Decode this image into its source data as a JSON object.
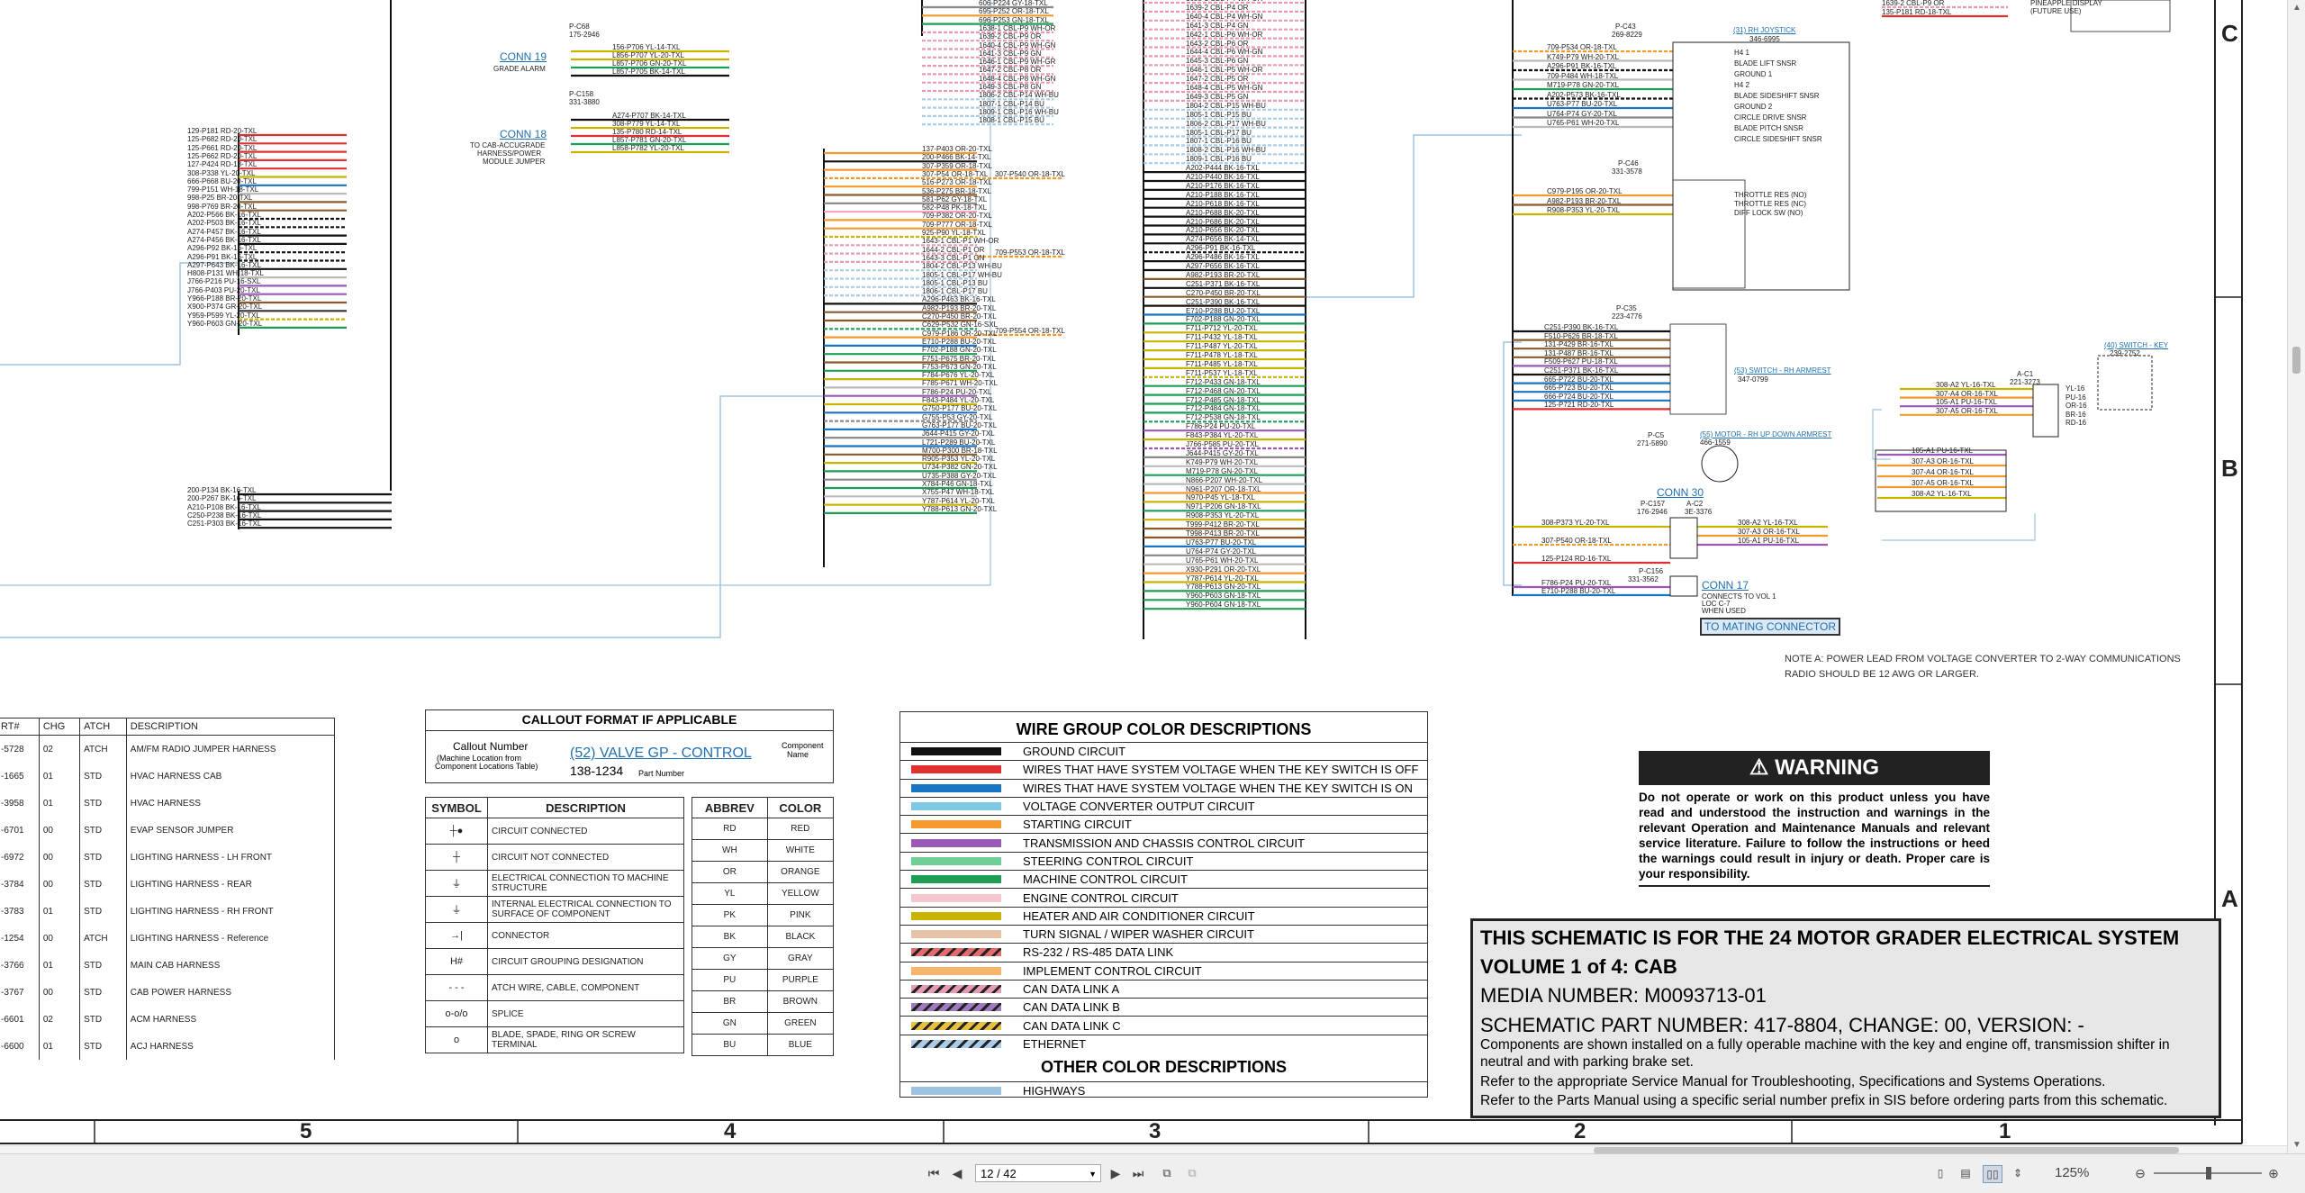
{
  "zones": {
    "c": "C",
    "b": "B",
    "a": "A"
  },
  "columns": [
    "5",
    "4",
    "3",
    "2",
    "1"
  ],
  "left_harness": [
    "129-P181 RD-20-TXL",
    "125-P682 RD-20-TXL",
    "125-P661 RD-20-TXL",
    "125-P662 RD-20-TXL",
    "127-P424 RD-18-TXL",
    "308-P338 YL-20-TXL",
    "666-P668 BU-20-TXL",
    "799-P151 WH-18-TXL",
    "998-P25 BR-20-TXL",
    "998-P769 BR-20-TXL",
    "A202-P566 BK-16-TXL",
    "A202-P503 BK-16-TXL",
    "A274-P457 BK-16-TXL",
    "A274-P456 BK-16-TXL",
    "A296-P92 BK-16-TXL",
    "A296-P91 BK-16-TXL",
    "A297-P643 BK-16-TXL",
    "H808-P131 WH-18-TXL",
    "J766-P216 PU-16-SXL",
    "J766-P403 PU-20-TXL",
    "Y966-P188 BR-20-TXL",
    "X900-P374 GR-20-TXL",
    "Y959-P599 YL-20-TXL",
    "Y960-P603 GN-20-TXL"
  ],
  "left_harness_low": [
    "200-P134 BK-16-TXL",
    "200-P267 BK-16-TXL",
    "A210-P108 BK-16-TXL",
    "C250-P238 BK-16-TXL",
    "C251-P303 BK-16-TXL"
  ],
  "conn19": {
    "title": "CONN 19",
    "sub": "GRADE ALARM",
    "pc": "P-C68",
    "pn": "175-2946",
    "wires": [
      "156-P706 YL-14-TXL",
      "L856-P707 YL-20-TXL",
      "L857-P706 GN-20-TXL",
      "L857-P705 BK-14-TXL"
    ]
  },
  "conn18": {
    "title": "CONN 18",
    "sub1": "TO CAB-ACCUGRADE",
    "sub2": "HARNESS/POWER",
    "sub3": "MODULE JUMPER",
    "pc": "P-C158",
    "pn": "331-3880",
    "wires": [
      "A274-P707 BK-14-TXL",
      "308-P779 YL-14-TXL",
      "135-P780 RD-14-TXL",
      "L857-P781 GN-20-TXL",
      "L858-P782 YL-20-TXL"
    ]
  },
  "mid_harness_top": [
    "606-P224 GY-18-TXL",
    "695-P252 OR-18-TXL",
    "696-P253 GN-18-TXL",
    "1638-1 CBL-P9 WH-OR",
    "1639-2 CBL-P9 OR",
    "1640-4 CBL-P9 WH-GN",
    "1641-3 CBL-P9 GN",
    "1646-1 CBL-P9 WH-GR",
    "1647-2 CBL-P8 OR",
    "1648-4 CBL-P8 WH-GN",
    "1649-3 CBL-P8 GN",
    "1806-2 CBL-P14 WH-BU",
    "1807-1 CBL-P14 BU",
    "1809-1 CBL-P16 WH-BU",
    "1808-1 CBL-P15 BU"
  ],
  "mid_harness": [
    "137-P403 OR-20-TXL",
    "200-P466 BK-14-TXL",
    "307-P359 OR-18-TXL",
    "307-P54 OR-18-TXL",
    "516-P273 OR-18-TXL",
    "536-P275 BR-18-TXL",
    "581-P62 GY-18-TXL",
    "582-P48 PK-18-TXL",
    "709-P382 OR-20-TXL",
    "709-P777 OR-18-TXL",
    "925-P90 YL-18-TXL",
    "1643-1 CBL-P1 WH-OR",
    "1644-2 CBL-P1 OR",
    "1643-3 CBL-P1 GN",
    "1804-2 CBL-P13 WH-BU",
    "1805-1 CBL-P17 WH-BU",
    "1805-1 CBL-P13 BU",
    "1806-1 CBL-P17 BU",
    "A296-P463 BK-16-TXL",
    "A982-P193 BR-20-TXL",
    "C270-P450 BR-20-TXL",
    "C629-P532 GN-16-SXL",
    "C979-P186 OR-20-TXL",
    "E710-P288 BU-20-TXL",
    "F702-P188 GN-20-TXL",
    "F751-P675 BR-20-TXL",
    "F753-P673 GN-20-TXL",
    "F784-P676 YL-20-TXL",
    "F785-P671 WH-20-TXL",
    "F786-P24 PU-20-TXL",
    "F843-P484 YL-20-TXL",
    "G750-P177 BU-20-TXL",
    "G755-P53 GY-20-TXL",
    "G763-P177 BU-20-TXL",
    "J644-P415 GY-20-TXL",
    "L721-P289 BU-20-TXL",
    "M700-P300 BR-18-TXL",
    "R905-P353 YL-20-TXL",
    "U734-P382 GN-20-TXL",
    "U735-P388 GY-20-TXL",
    "X784-P46 GN-18-TXL",
    "X755-P47 WH-18-TXL",
    "Y787-P614 YL-20-TXL",
    "Y788-P613 GN-20-TXL"
  ],
  "mid_right": [
    "307-P540 OR-18-TXL",
    "709-P553 OR-18-TXL",
    "709-P554 OR-18-TXL"
  ],
  "trunk": [
    "1638-1 CBL-P4 WH-OR",
    "1639-2 CBL-P4 OR",
    "1640-4 CBL-P4 WH-GN",
    "1641-3 CBL-P4 GN",
    "1642-1 CBL-P6 WH-OR",
    "1643-2 CBL-P6 OR",
    "1644-4 CBL-P6 WH-GN",
    "1645-3 CBL-P6 GN",
    "1646-1 CBL-P5 WH-OR",
    "1647-2 CBL-P5 OR",
    "1648-4 CBL-P5 WH-GN",
    "1649-3 CBL-P5 GN",
    "1804-2 CBL-P15 WH-BU",
    "1805-1 CBL-P15 BU",
    "1806-2 CBL-P17 WH-BU",
    "1805-1 CBL-P17 BU",
    "1807-1 CBL-P16 BU",
    "1808-2 CBL-P16 WH-BU",
    "1809-1 CBL-P16 BU",
    "A202-P444 BK-16-TXL",
    "A210-P440 BK-16-TXL",
    "A210-P176 BK-16-TXL",
    "A210-P188 BK-16-TXL",
    "A210-P618 BK-16-TXL",
    "A210-P688 BK-20-TXL",
    "A210-P686 BK-20-TXL",
    "A210-P656 BK-20-TXL",
    "A274-P656 BK-14-TXL",
    "A296-P91 BK-16-TXL",
    "A296-P486 BK-16-TXL",
    "A297-P656 BK-16-TXL",
    "A982-P193 BR-20-TXL",
    "C251-P371 BK-16-TXL",
    "C270-P450 BR-20-TXL",
    "C251-P390 BK-16-TXL",
    "E710-P288 BU-20-TXL",
    "F702-P188 GN-20-TXL",
    "F711-P712 YL-20-TXL",
    "F711-P432 YL-18-TXL",
    "F711-P487 YL-20-TXL",
    "F711-P478 YL-18-TXL",
    "F711-P485 YL-18-TXL",
    "F711-P537 YL-18-TXL",
    "F712-P433 GN-18-TXL",
    "F712-P468 GN-20-TXL",
    "F712-P485 GN-18-TXL",
    "F712-P484 GN-18-TXL",
    "F712-P538 GN-18-TXL",
    "F786-P24 PU-20-TXL",
    "F843-P384 YL-20-TXL",
    "J766-P585 PU-20-TXL",
    "J644-P415 GY-20-TXL",
    "K749-P79 WH-20-TXL",
    "M719-P78 GN-20-TXL",
    "N866-P207 WH-20-TXL",
    "N961-P207 OR-18-TXL",
    "N970-P45 YL-18-TXL",
    "N971-P206 GN-18-TXL",
    "R908-P353 YL-20-TXL",
    "T999-P412 BR-20-TXL",
    "T998-P413 BR-20-TXL",
    "U763-P77 BU-20-TXL",
    "U764-P74 GY-20-TXL",
    "U765-P61 WH-20-TXL",
    "X930-P291 OR-20-TXL",
    "Y787-P614 YL-20-TXL",
    "Y788-P613 GN-20-TXL",
    "Y960-P603 GN-18-TXL",
    "Y960-P604 GN-18-TXL"
  ],
  "topright": {
    "wires": [
      "1639-2 CBL-P9 OR",
      "135-P181 RD-18-TXL"
    ],
    "note1": "PINEAPPLE DISPLAY",
    "note2": "(FUTURE USE)"
  },
  "joystick": {
    "pc": "P-C43",
    "pn": "269-8229",
    "title": "(31) RH JOYSTICK",
    "num": "346-6995",
    "wires": [
      "709-P534 OR-18-TXL",
      "K749-P79 WH-20-TXL",
      "A296-P91 BK-16-TXL",
      "709-P484 WH-18-TXL",
      "M719-P78 GN-20-TXL",
      "A202-P573 BK-16-TXL",
      "U763-P77 BU-20-TXL",
      "U764-P74 GY-20-TXL",
      "U765-P61 WH-20-TXL"
    ],
    "labels": [
      "H4 1",
      "BLADE LIFT SNSR",
      "GROUND 1",
      "H4 2",
      "BLADE SIDESHIFT SNSR",
      "GROUND 2",
      "CIRCLE DRIVE SNSR",
      "BLADE PITCH SNSR",
      "CIRCLE SIDESHIFT SNSR"
    ],
    "pc2": "P-C46",
    "pn2": "331-3578",
    "wires2": [
      "C979-P195 OR-20-TXL",
      "A982-P193 BR-20-TXL",
      "R908-P353 YL-20-TXL"
    ],
    "labels2": [
      "THROTTLE RES (NO)",
      "THROTTLE RES (NC)",
      "DIFF LOCK SW (NO)"
    ]
  },
  "armrest": {
    "pc": "P-C35",
    "pn": "223-4776",
    "title": "(53) SWITCH - RH ARMREST",
    "num": "347-0799",
    "wires": [
      "C251-P390 BK-16-TXL",
      "F510-P626 BR-18-TXL",
      "131-P429 BR-16-TXL",
      "131-P487 BR-16-TXL",
      "F509-P627 PU-18-TXL",
      "C251-P371 BK-16-TXL",
      "665-P722 BU-20-TXL",
      "665-P723 BU-20-TXL",
      "666-P724 BU-20-TXL",
      "125-P721 RD-20-TXL"
    ]
  },
  "motor": {
    "pc": "P-C5",
    "pn": "271-5890",
    "title": "(55) MOTOR - RH UP DOWN ARMREST",
    "num": "466-1559"
  },
  "keyswitch": {
    "title": "(40) SWITCH - KEY",
    "num": "239-2752",
    "pc": "A-C1",
    "pn": "221-3273",
    "wires": [
      "308-A2 YL-16-TXL",
      "307-A4 OR-16-TXL",
      "105-A1 PU-16-TXL",
      "307-A5 OR-16-TXL"
    ],
    "pins": [
      "YL-16",
      "PU-16",
      "OR-16",
      "BR-16",
      "RD-16"
    ],
    "loop": [
      "105-A1 PU-16-TXL",
      "307-A3 OR-16-TXL",
      "307-A4 OR-16-TXL",
      "307-A5 OR-16-TXL",
      "308-A2 YL-16-TXL"
    ]
  },
  "conn30": {
    "title": "CONN 30",
    "pc": "P-C157",
    "pn": "176-2946",
    "ac": "A-C2",
    "an": "3E-3376",
    "wires": [
      "308-P373 YL-20-TXL",
      "307-P540 OR-18-TXL",
      "125-P124 RD-16-TXL"
    ],
    "right": [
      "308-A2 YL-16-TXL",
      "307-A3 OR-16-TXL",
      "105-A1 PU-16-TXL"
    ]
  },
  "conn17": {
    "title": "CONN 17",
    "pc": "P-C156",
    "pn": "331-3562",
    "wires": [
      "F786-P24 PU-20-TXL",
      "E710-P288 BU-20-TXL"
    ],
    "sub1": "CONNECTS TO VOL 1",
    "sub2": "LOC C-7",
    "sub3": "WHEN USED",
    "mating": "TO MATING CONNECTOR"
  },
  "note_a": {
    "line1": "NOTE A: POWER LEAD FROM VOLTAGE CONVERTER TO 2-WAY COMMUNICATIONS",
    "line2": "RADIO SHOULD BE 12 AWG OR LARGER."
  },
  "parts_table": {
    "headers": [
      "RT#",
      "CHG",
      "ATCH",
      "DESCRIPTION"
    ],
    "rows": [
      [
        "-5728",
        "02",
        "ATCH",
        "AM/FM RADIO JUMPER HARNESS"
      ],
      [
        "-1665",
        "01",
        "STD",
        "HVAC HARNESS CAB"
      ],
      [
        "-3958",
        "01",
        "STD",
        "HVAC HARNESS"
      ],
      [
        "-6701",
        "00",
        "STD",
        "EVAP SENSOR JUMPER"
      ],
      [
        "-6972",
        "00",
        "STD",
        "LIGHTING HARNESS - LH FRONT"
      ],
      [
        "-3784",
        "00",
        "STD",
        "LIGHTING HARNESS - REAR"
      ],
      [
        "-3783",
        "01",
        "STD",
        "LIGHTING HARNESS - RH FRONT"
      ],
      [
        "-1254",
        "00",
        "ATCH",
        "LIGHTING HARNESS - Reference"
      ],
      [
        "-3766",
        "01",
        "STD",
        "MAIN CAB HARNESS"
      ],
      [
        "-3767",
        "00",
        "STD",
        "CAB POWER HARNESS"
      ],
      [
        "-6601",
        "02",
        "STD",
        "ACM HARNESS"
      ],
      [
        "-6600",
        "01",
        "STD",
        "ACJ HARNESS"
      ]
    ]
  },
  "callout": {
    "title": "CALLOUT FORMAT IF APPLICABLE",
    "callout_number": "Callout Number",
    "machine_loc1": "(Machine Location from",
    "machine_loc2": "Component Locations Table)",
    "example": "(52) VALVE GP - CONTROL",
    "component": "Component",
    "name": "Name",
    "partnum": "138-1234",
    "partnum_label": "Part Number"
  },
  "symbols": {
    "headers": [
      "SYMBOL",
      "DESCRIPTION"
    ],
    "rows": [
      {
        "sym": "┼●",
        "desc": "CIRCUIT CONNECTED"
      },
      {
        "sym": "┼",
        "desc": "CIRCUIT NOT CONNECTED"
      },
      {
        "sym": "⏚",
        "desc": "ELECTRICAL CONNECTION TO MACHINE STRUCTURE"
      },
      {
        "sym": "⏚",
        "desc": "INTERNAL ELECTRICAL CONNECTION TO SURFACE OF COMPONENT"
      },
      {
        "sym": "→|",
        "desc": "CONNECTOR"
      },
      {
        "sym": "H#",
        "desc": "CIRCUIT GROUPING DESIGNATION"
      },
      {
        "sym": "- - -",
        "desc": "ATCH WIRE, CABLE, COMPONENT"
      },
      {
        "sym": "o-o/o",
        "desc": "SPLICE"
      },
      {
        "sym": "o",
        "desc": "BLADE, SPADE, RING OR SCREW TERMINAL"
      }
    ]
  },
  "abbrev": {
    "headers": [
      "ABBREV",
      "COLOR"
    ],
    "rows": [
      [
        "RD",
        "RED"
      ],
      [
        "WH",
        "WHITE"
      ],
      [
        "OR",
        "ORANGE"
      ],
      [
        "YL",
        "YELLOW"
      ],
      [
        "PK",
        "PINK"
      ],
      [
        "BK",
        "BLACK"
      ],
      [
        "GY",
        "GRAY"
      ],
      [
        "PU",
        "PURPLE"
      ],
      [
        "BR",
        "BROWN"
      ],
      [
        "GN",
        "GREEN"
      ],
      [
        "BU",
        "BLUE"
      ]
    ]
  },
  "wire_groups": {
    "title": "WIRE GROUP COLOR DESCRIPTIONS",
    "rows": [
      {
        "color": "#111111",
        "pattern": "",
        "desc": "GROUND CIRCUIT"
      },
      {
        "color": "#e03030",
        "pattern": "",
        "desc": "WIRES THAT HAVE SYSTEM VOLTAGE WHEN THE KEY SWITCH IS OFF"
      },
      {
        "color": "#1a74c4",
        "pattern": "",
        "desc": "WIRES THAT HAVE SYSTEM VOLTAGE WHEN THE KEY SWITCH IS ON"
      },
      {
        "color": "#7ec8e3",
        "pattern": "",
        "desc": "VOLTAGE CONVERTER OUTPUT CIRCUIT"
      },
      {
        "color": "#f29a2e",
        "pattern": "",
        "desc": "STARTING CIRCUIT"
      },
      {
        "color": "#9b59b6",
        "pattern": "",
        "desc": "TRANSMISSION AND CHASSIS CONTROL CIRCUIT"
      },
      {
        "color": "#6fcf97",
        "pattern": "",
        "desc": "STEERING CONTROL CIRCUIT"
      },
      {
        "color": "#1e9e55",
        "pattern": "",
        "desc": "MACHINE CONTROL CIRCUIT"
      },
      {
        "color": "#f6c6d0",
        "pattern": "",
        "desc": "ENGINE CONTROL CIRCUIT"
      },
      {
        "color": "#c8b400",
        "pattern": "",
        "desc": "HEATER AND AIR CONDITIONER CIRCUIT"
      },
      {
        "color": "#e8c3a8",
        "pattern": "",
        "desc": "TURN SIGNAL / WIPER WASHER CIRCUIT"
      },
      {
        "color": "#e36b6b",
        "pattern": "stripe",
        "desc": "RS-232 / RS-485 DATA LINK"
      },
      {
        "color": "#f7b46b",
        "pattern": "",
        "desc": "IMPLEMENT CONTROL CIRCUIT"
      },
      {
        "color": "#e89ab0",
        "pattern": "stripe",
        "desc": "CAN DATA LINK A"
      },
      {
        "color": "#a07ac0",
        "pattern": "stripe",
        "desc": "CAN DATA LINK B"
      },
      {
        "color": "#e8c040",
        "pattern": "stripe",
        "desc": "CAN DATA LINK C"
      },
      {
        "color": "#a9cde8",
        "pattern": "stripe",
        "desc": "ETHERNET"
      }
    ],
    "other_title": "OTHER COLOR DESCRIPTIONS",
    "other": [
      {
        "color": "#9ec3e0",
        "desc": "HIGHWAYS"
      }
    ]
  },
  "warning": {
    "title": "WARNING",
    "text": "Do not operate or work on this product unless you have read and understood the instruction and warnings in the relevant Operation and Maintenance Manuals and relevant service literature. Failure to follow the instructions or heed the warnings could result in injury or death. Proper care is your responsibility."
  },
  "title_block": {
    "line1": "THIS SCHEMATIC IS FOR THE 24 MOTOR GRADER ELECTRICAL SYSTEM",
    "line2": "VOLUME 1 of 4: CAB",
    "line3": "MEDIA NUMBER: M0093713-01",
    "line4": "SCHEMATIC PART NUMBER: 417-8804, CHANGE: 00, VERSION: -",
    "line5": "Components are shown installed on a fully operable machine with the key and engine off, transmission shifter in neutral and with parking brake set.",
    "line6": "Refer to the appropriate Service Manual for Troubleshooting, Specifications and Systems Operations.",
    "line7": "Refer to the Parts Manual using a specific serial number prefix in SIS before ordering parts from this schematic."
  },
  "toolbar": {
    "page_value": "12 / 42",
    "zoom": "125%",
    "first_page": "⏮",
    "prev_page": "◀",
    "next_page": "▶",
    "last_page": "⏭",
    "zoom_out": "⊖",
    "zoom_in": "⊕"
  }
}
